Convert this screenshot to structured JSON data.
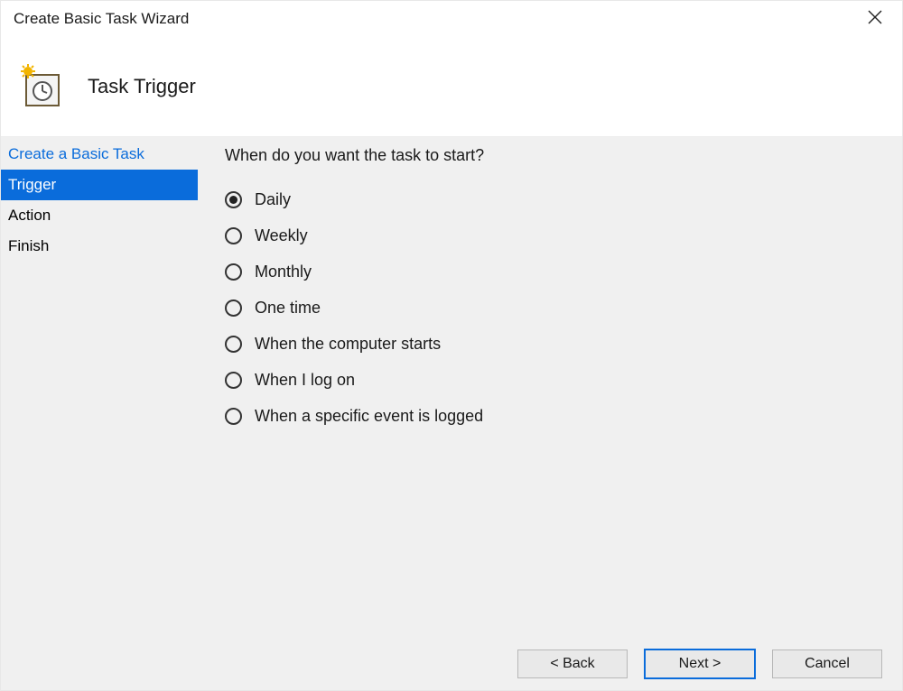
{
  "window": {
    "title": "Create Basic Task Wizard"
  },
  "header": {
    "icon_name": "calendar-clock-icon",
    "page_title": "Task Trigger"
  },
  "sidebar": {
    "steps": [
      {
        "label": "Create a Basic Task",
        "state": "link"
      },
      {
        "label": "Trigger",
        "state": "active"
      },
      {
        "label": "Action",
        "state": "normal"
      },
      {
        "label": "Finish",
        "state": "normal"
      }
    ]
  },
  "content": {
    "question": "When do you want the task to start?",
    "options": [
      {
        "label": "Daily",
        "checked": true
      },
      {
        "label": "Weekly",
        "checked": false
      },
      {
        "label": "Monthly",
        "checked": false
      },
      {
        "label": "One time",
        "checked": false
      },
      {
        "label": "When the computer starts",
        "checked": false
      },
      {
        "label": "When I log on",
        "checked": false
      },
      {
        "label": "When a specific event is logged",
        "checked": false
      }
    ]
  },
  "footer": {
    "back_label": "< Back",
    "next_label": "Next >",
    "cancel_label": "Cancel"
  }
}
